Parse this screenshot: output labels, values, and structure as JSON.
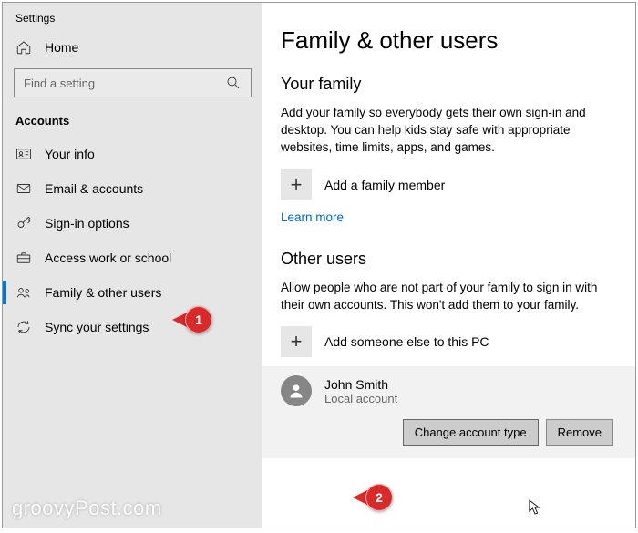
{
  "settings_label": "Settings",
  "home_label": "Home",
  "search": {
    "placeholder": "Find a setting"
  },
  "category_label": "Accounts",
  "nav": {
    "your_info": "Your info",
    "email": "Email & accounts",
    "signin": "Sign-in options",
    "work": "Access work or school",
    "family": "Family & other users",
    "sync": "Sync your settings"
  },
  "page": {
    "title": "Family & other users",
    "family": {
      "heading": "Your family",
      "desc": "Add your family so everybody gets their own sign-in and desktop. You can help kids stay safe with appropriate websites, time limits, apps, and games.",
      "add_label": "Add a family member",
      "learn": "Learn more"
    },
    "other": {
      "heading": "Other users",
      "desc": "Allow people who are not part of your family to sign in with their own accounts. This won't add them to your family.",
      "add_label": "Add someone else to this PC"
    },
    "user": {
      "name": "John Smith",
      "type": "Local account",
      "change": "Change account type",
      "remove": "Remove"
    }
  },
  "annotations": {
    "m1": "1",
    "m2": "2"
  },
  "watermark": "groovyPost.com"
}
